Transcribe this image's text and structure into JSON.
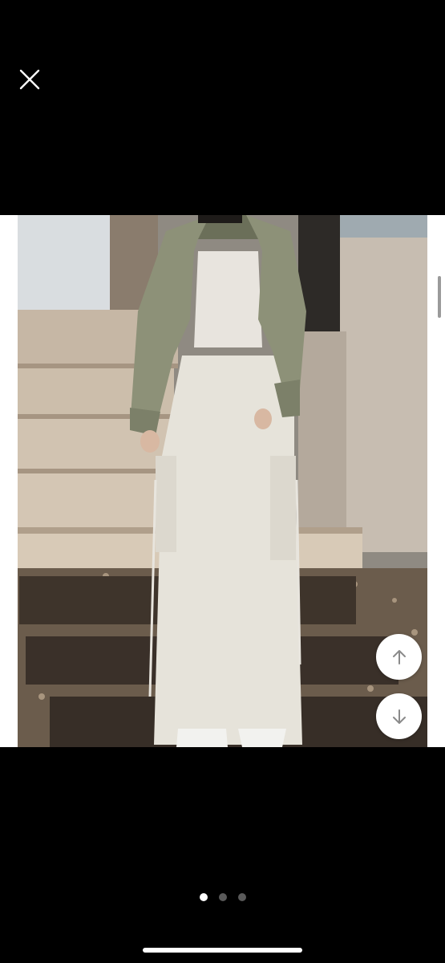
{
  "viewer": {
    "close_icon": "close-icon",
    "photo_alt": "",
    "nav": {
      "up_icon": "arrow-up-icon",
      "down_icon": "arrow-down-icon"
    },
    "pagination": {
      "total": 3,
      "current": 1
    }
  },
  "colors": {
    "background": "#000000",
    "viewer_bg": "#ffffff",
    "dot_active": "#ffffff",
    "dot_inactive": "#5a5a5a"
  }
}
